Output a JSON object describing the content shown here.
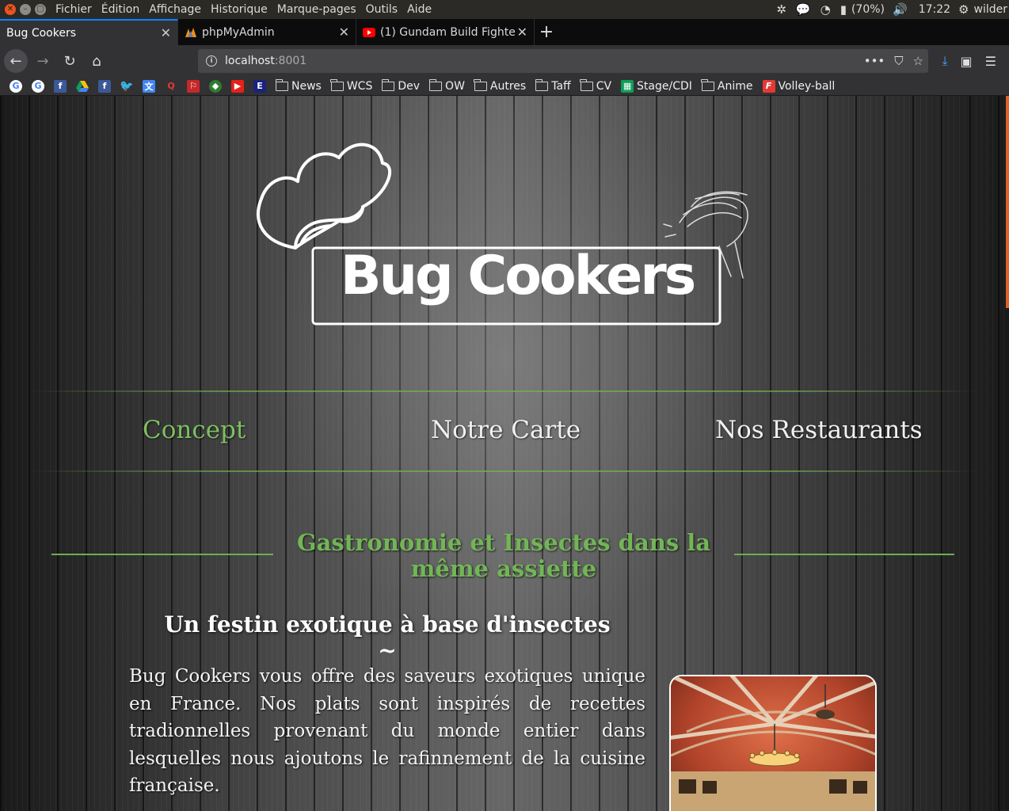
{
  "os_menu": {
    "items": [
      "Fichier",
      "Édition",
      "Affichage",
      "Historique",
      "Marque-pages",
      "Outils",
      "Aide"
    ],
    "battery": "(70%)",
    "time": "17:22",
    "user": "wilder"
  },
  "tabs": [
    {
      "label": "Bug Cookers",
      "active": true
    },
    {
      "label": "phpMyAdmin",
      "active": false
    },
    {
      "label": "(1) Gundam Build Fighte",
      "active": false
    }
  ],
  "urlbar": {
    "host": "localhost",
    "port": ":8001"
  },
  "bookmarks": {
    "folders": [
      "News",
      "WCS",
      "Dev",
      "OW",
      "Autres",
      "Taff",
      "CV",
      "Stage/CDI",
      "Anime",
      "Volley-ball"
    ]
  },
  "site": {
    "logo_text": "Bug Cookers",
    "nav": {
      "concept": "Concept",
      "carte": "Notre Carte",
      "restaurants": "Nos Restaurants"
    },
    "section_title": "Gastronomie et Insectes dans la même assiette",
    "subtitle": "Un festin exotique à base d'insectes",
    "tilde": "~",
    "intro": "Bug Cookers vous offre des saveurs exotiques unique en France. Nos plats sont inspirés de recettes tradionnelles provenant du monde entier dans lesquelles nous ajoutons le rafinnement de la cuisine française.",
    "accent_color": "#6dae52"
  }
}
